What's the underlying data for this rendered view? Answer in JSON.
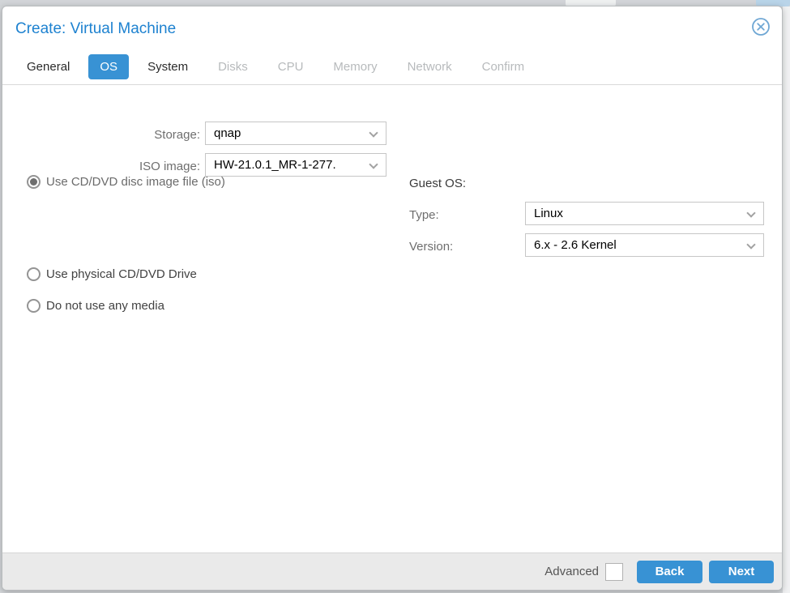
{
  "window": {
    "title": "Create: Virtual Machine"
  },
  "tabs": [
    {
      "label": "General",
      "active": false,
      "enabled": true
    },
    {
      "label": "OS",
      "active": true,
      "enabled": true
    },
    {
      "label": "System",
      "active": false,
      "enabled": true
    },
    {
      "label": "Disks",
      "active": false,
      "enabled": false
    },
    {
      "label": "CPU",
      "active": false,
      "enabled": false
    },
    {
      "label": "Memory",
      "active": false,
      "enabled": false
    },
    {
      "label": "Network",
      "active": false,
      "enabled": false
    },
    {
      "label": "Confirm",
      "active": false,
      "enabled": false
    }
  ],
  "media": {
    "options": [
      {
        "label": "Use CD/DVD disc image file (iso)",
        "selected": true
      },
      {
        "label": "Use physical CD/DVD Drive",
        "selected": false
      },
      {
        "label": "Do not use any media",
        "selected": false
      }
    ],
    "storage": {
      "label": "Storage:",
      "value": "qnap"
    },
    "iso": {
      "label": "ISO image:",
      "value": "HW-21.0.1_MR-1-277."
    }
  },
  "guest_os": {
    "heading": "Guest OS:",
    "type": {
      "label": "Type:",
      "value": "Linux"
    },
    "version": {
      "label": "Version:",
      "value": "6.x - 2.6 Kernel"
    }
  },
  "footer": {
    "advanced_label": "Advanced",
    "advanced_checked": false,
    "back_label": "Back",
    "next_label": "Next"
  },
  "colors": {
    "title_text": "#1e82d0",
    "active_tab_bg": "#3892d4",
    "button_bg": "#3892d4",
    "disabled_tab_text": "#b7babc",
    "footer_bg": "#eaeaea",
    "close_icon": "#6fa7d4"
  }
}
